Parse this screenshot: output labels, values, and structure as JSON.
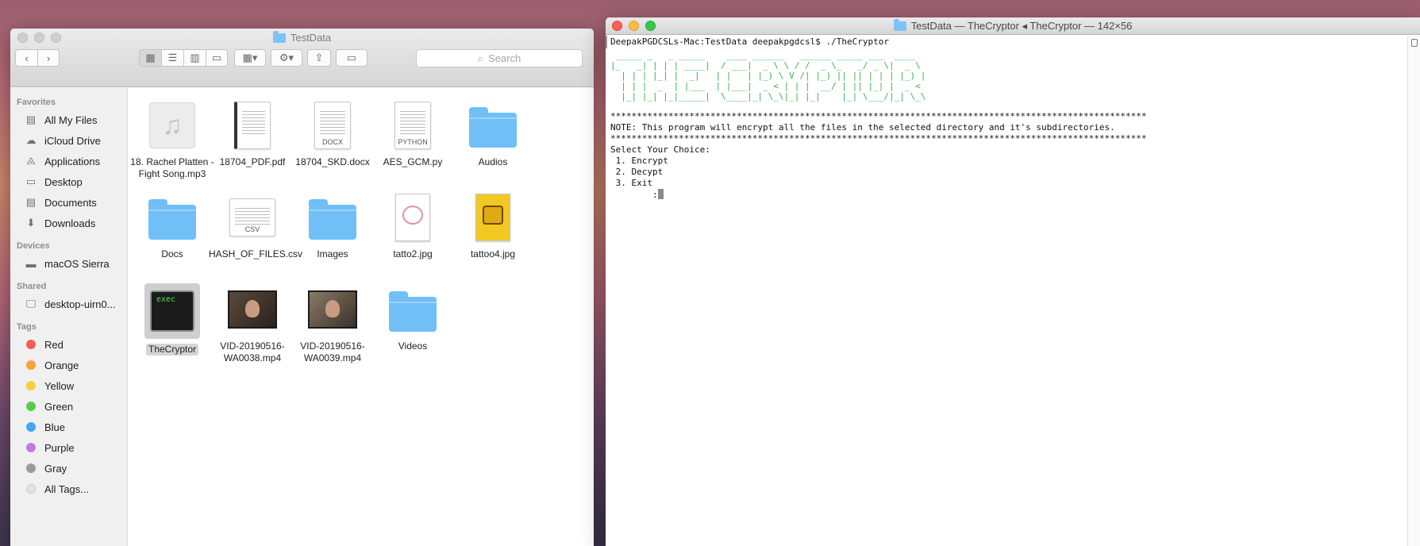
{
  "finder": {
    "title": "TestData",
    "search_placeholder": "Search",
    "sidebar": {
      "favorites_header": "Favorites",
      "favorites": [
        {
          "label": "All My Files",
          "icon": "all-files-icon"
        },
        {
          "label": "iCloud Drive",
          "icon": "cloud-icon"
        },
        {
          "label": "Applications",
          "icon": "applications-icon"
        },
        {
          "label": "Desktop",
          "icon": "desktop-icon"
        },
        {
          "label": "Documents",
          "icon": "documents-icon"
        },
        {
          "label": "Downloads",
          "icon": "downloads-icon"
        }
      ],
      "devices_header": "Devices",
      "devices": [
        {
          "label": "macOS Sierra",
          "icon": "disk-icon"
        }
      ],
      "shared_header": "Shared",
      "shared": [
        {
          "label": "desktop-uirn0...",
          "icon": "computer-icon"
        }
      ],
      "tags_header": "Tags",
      "tags": [
        {
          "label": "Red",
          "color": "#f25f58"
        },
        {
          "label": "Orange",
          "color": "#f6a33a"
        },
        {
          "label": "Yellow",
          "color": "#f5d03c"
        },
        {
          "label": "Green",
          "color": "#5ccb4d"
        },
        {
          "label": "Blue",
          "color": "#3da9f2"
        },
        {
          "label": "Purple",
          "color": "#c17ce0"
        },
        {
          "label": "Gray",
          "color": "#9b9b9b"
        },
        {
          "label": "All Tags...",
          "color": "#e3e3e3"
        }
      ]
    },
    "files": [
      {
        "name": "18. Rachel Platten - Fight Song.mp3",
        "kind": "music-icon"
      },
      {
        "name": "18704_PDF.pdf",
        "kind": "pdf-icon"
      },
      {
        "name": "18704_SKD.docx",
        "kind": "docx-icon",
        "badge": "DOCX"
      },
      {
        "name": "AES_GCM.py",
        "kind": "python-icon",
        "badge": "PYTHON"
      },
      {
        "name": "Audios",
        "kind": "folder-icon"
      },
      {
        "name": "Docs",
        "kind": "folder-icon"
      },
      {
        "name": "HASH_OF_FILES.csv",
        "kind": "csv-icon",
        "badge": "CSV"
      },
      {
        "name": "Images",
        "kind": "folder-icon"
      },
      {
        "name": "tatto2.jpg",
        "kind": "image-icon"
      },
      {
        "name": "tattoo4.jpg",
        "kind": "image-icon"
      },
      {
        "name": "TheCryptor",
        "kind": "exec-icon",
        "badge": "exec",
        "selected": true
      },
      {
        "name": "VID-20190516-WA0038.mp4",
        "kind": "video-icon"
      },
      {
        "name": "VID-20190516-WA0039.mp4",
        "kind": "video-icon"
      },
      {
        "name": "Videos",
        "kind": "folder-icon"
      }
    ]
  },
  "terminal": {
    "title": "TestData — TheCryptor ◂ TheCryptor — 142×56",
    "prompt_line": "DeepakPGDCSLs-Mac:TestData deepakpgdcsl$ ./TheCryptor",
    "banner": " _____ _   _ _____    ____ ______   ______ _____ ___  ____  \n|_   _| | | | ____|  / ___|  _ \\ \\ / /  _ \\_   _/ _ \\|  _ \\ \n  | | | |_| |  _|   | |   | |_) \\ V /| |_) || || | | | |_) |\n  | | |  _  | |___  | |___|  _ < | | |  __/ | || |_| |  _ < \n  |_| |_| |_|_____|  \\____|_| \\_\\|_| |_|    |_| \\___/|_| \\_\\",
    "stars": "******************************************************************************************************",
    "note": "NOTE: This program will encrypt all the files in the selected directory and it's subdirectories.",
    "select": "Select Your Choice:",
    "opt1": " 1. Encrypt",
    "opt2": " 2. Decypt",
    "opt3": " 3. Exit",
    "input_prompt": "        :"
  }
}
